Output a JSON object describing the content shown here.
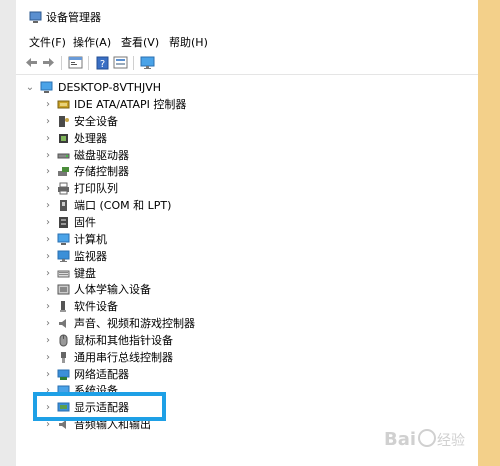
{
  "window": {
    "title": "设备管理器"
  },
  "menu": [
    "文件(F)",
    "操作(A)",
    "查看(V)",
    "帮助(H)"
  ],
  "toolbar": [
    "back-arrow-icon",
    "forward-arrow-icon",
    "properties-icon",
    "help-icon",
    "device-view-icon",
    "monitor-icon"
  ],
  "tree": {
    "root": "DESKTOP-8VTHJVH",
    "items": [
      {
        "label": "IDE ATA/ATAPI 控制器",
        "icon": "ide-controller-icon"
      },
      {
        "label": "安全设备",
        "icon": "security-device-icon"
      },
      {
        "label": "处理器",
        "icon": "processor-icon"
      },
      {
        "label": "磁盘驱动器",
        "icon": "disk-drive-icon"
      },
      {
        "label": "存储控制器",
        "icon": "storage-controller-icon"
      },
      {
        "label": "打印队列",
        "icon": "printer-icon"
      },
      {
        "label": "端口 (COM 和 LPT)",
        "icon": "port-icon"
      },
      {
        "label": "固件",
        "icon": "firmware-icon"
      },
      {
        "label": "计算机",
        "icon": "computer-icon"
      },
      {
        "label": "监视器",
        "icon": "monitor-icon"
      },
      {
        "label": "键盘",
        "icon": "keyboard-icon"
      },
      {
        "label": "人体学输入设备",
        "icon": "hid-icon"
      },
      {
        "label": "软件设备",
        "icon": "software-device-icon"
      },
      {
        "label": "声音、视频和游戏控制器",
        "icon": "sound-icon"
      },
      {
        "label": "鼠标和其他指针设备",
        "icon": "mouse-icon"
      },
      {
        "label": "通用串行总线控制器",
        "icon": "usb-icon"
      },
      {
        "label": "网络适配器",
        "icon": "network-icon"
      },
      {
        "label": "系统设备",
        "icon": "system-device-icon"
      },
      {
        "label": "显示适配器",
        "icon": "display-adapter-icon"
      },
      {
        "label": "音频输入和输出",
        "icon": "audio-io-icon"
      }
    ]
  },
  "colors": {
    "highlight": "#1ea0e6",
    "accent_icon": "#2a7fd4"
  },
  "watermark": "Baidu 经验"
}
